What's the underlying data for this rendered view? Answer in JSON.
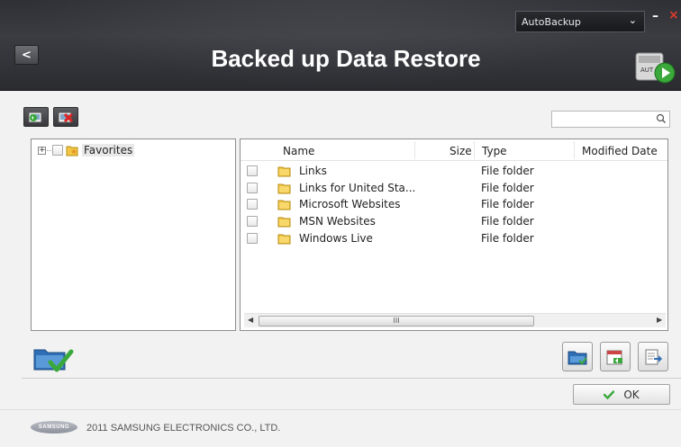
{
  "header": {
    "title": "Backed up Data Restore",
    "back_label": "<",
    "mode_select": {
      "selected": "AutoBackup",
      "caret": "⌄"
    },
    "minimize_label": "–",
    "close_label": "×"
  },
  "toolbar": {
    "search_placeholder": ""
  },
  "tree": {
    "items": [
      {
        "label": "Favorites",
        "expander": "+"
      }
    ]
  },
  "file_list": {
    "columns": [
      "Name",
      "Size",
      "Type",
      "Modified Date"
    ],
    "rows": [
      {
        "name": "Links",
        "size": "",
        "type": "File folder",
        "modified": ""
      },
      {
        "name": "Links for United Sta...",
        "size": "",
        "type": "File folder",
        "modified": ""
      },
      {
        "name": "Microsoft Websites",
        "size": "",
        "type": "File folder",
        "modified": ""
      },
      {
        "name": "MSN Websites",
        "size": "",
        "type": "File folder",
        "modified": ""
      },
      {
        "name": "Windows Live",
        "size": "",
        "type": "File folder",
        "modified": ""
      }
    ],
    "scroll_left": "◀",
    "scroll_right": "▶",
    "scroll_grip": "III"
  },
  "ok_button": {
    "label": "OK"
  },
  "footer": {
    "logo_text": "SAMSUNG",
    "copyright": "2011 SAMSUNG ELECTRONICS CO., LTD."
  },
  "colors": {
    "header_bg": "#2f3035",
    "accent_green": "#3aa83a",
    "close_red": "#e03a2a",
    "folder_yellow": "#f2c744"
  }
}
